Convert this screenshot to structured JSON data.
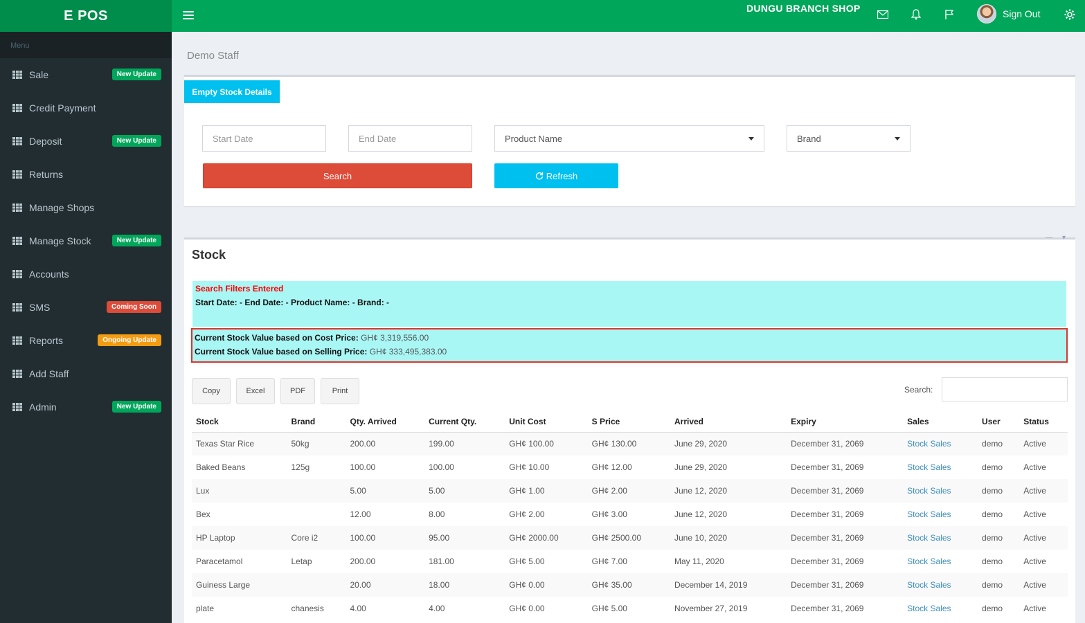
{
  "app": {
    "logo": "E POS"
  },
  "topbar": {
    "shop_name": "DUNGU BRANCH SHOP",
    "sign_out": "Sign Out"
  },
  "sidebar": {
    "header": "Menu",
    "items": [
      {
        "label": "Sale",
        "badge": "New Update",
        "badge_color": "#00a65a"
      },
      {
        "label": "Credit Payment",
        "badge": "",
        "badge_color": ""
      },
      {
        "label": "Deposit",
        "badge": "New Update",
        "badge_color": "#00a65a"
      },
      {
        "label": "Returns",
        "badge": "",
        "badge_color": ""
      },
      {
        "label": "Manage Shops",
        "badge": "",
        "badge_color": ""
      },
      {
        "label": "Manage Stock",
        "badge": "New Update",
        "badge_color": "#00a65a"
      },
      {
        "label": "Accounts",
        "badge": "",
        "badge_color": ""
      },
      {
        "label": "SMS",
        "badge": "Coming Soon",
        "badge_color": "#dd4b39"
      },
      {
        "label": "Reports",
        "badge": "Ongoing Update",
        "badge_color": "#f39c12"
      },
      {
        "label": "Add Staff",
        "badge": "",
        "badge_color": ""
      },
      {
        "label": "Admin",
        "badge": "New Update",
        "badge_color": "#00a65a"
      }
    ]
  },
  "breadcrumb": "Demo Staff",
  "filters": {
    "tag": "Empty Stock Details",
    "start_date_placeholder": "Start Date",
    "end_date_placeholder": "End Date",
    "product_name": "Product Name",
    "brand": "Brand",
    "search_button": "Search",
    "refresh_button": "Refresh"
  },
  "stock": {
    "title": "Stock",
    "filters_heading": "Search Filters Entered",
    "filters_line": "Start Date: - End Date: - Product Name: - Brand: -",
    "cost_label": "Current Stock Value based on Cost Price:",
    "cost_value": "GH¢ 3,319,556.00",
    "selling_label": "Current Stock Value based on Selling Price:",
    "selling_value": "GH¢ 333,495,383.00",
    "export_buttons": [
      "Copy",
      "Excel",
      "PDF",
      "Print"
    ],
    "search_label": "Search:",
    "columns": [
      "Stock",
      "Brand",
      "Qty. Arrived",
      "Current Qty.",
      "Unit Cost",
      "S Price",
      "Arrived",
      "Expiry",
      "Sales",
      "User",
      "Status"
    ],
    "rows": [
      [
        "Texas Star Rice",
        "50kg",
        "200.00",
        "199.00",
        "GH¢ 100.00",
        "GH¢ 130.00",
        "June 29, 2020",
        "December 31, 2069",
        "Stock Sales",
        "demo",
        "Active"
      ],
      [
        "Baked Beans",
        "125g",
        "100.00",
        "100.00",
        "GH¢ 10.00",
        "GH¢ 12.00",
        "June 29, 2020",
        "December 31, 2069",
        "Stock Sales",
        "demo",
        "Active"
      ],
      [
        "Lux",
        "",
        "5.00",
        "5.00",
        "GH¢ 1.00",
        "GH¢ 2.00",
        "June 12, 2020",
        "December 31, 2069",
        "Stock Sales",
        "demo",
        "Active"
      ],
      [
        "Bex",
        "",
        "12.00",
        "8.00",
        "GH¢ 2.00",
        "GH¢ 3.00",
        "June 12, 2020",
        "December 31, 2069",
        "Stock Sales",
        "demo",
        "Active"
      ],
      [
        "HP Laptop",
        "Core i2",
        "100.00",
        "95.00",
        "GH¢ 2000.00",
        "GH¢ 2500.00",
        "June 10, 2020",
        "December 31, 2069",
        "Stock Sales",
        "demo",
        "Active"
      ],
      [
        "Paracetamol",
        "Letap",
        "200.00",
        "181.00",
        "GH¢ 5.00",
        "GH¢ 7.00",
        "May 11, 2020",
        "December 31, 2069",
        "Stock Sales",
        "demo",
        "Active"
      ],
      [
        "Guiness Large",
        "",
        "20.00",
        "18.00",
        "GH¢ 0.00",
        "GH¢ 35.00",
        "December 14, 2019",
        "December 31, 2069",
        "Stock Sales",
        "demo",
        "Active"
      ],
      [
        "plate",
        "chanesis",
        "4.00",
        "4.00",
        "GH¢ 0.00",
        "GH¢ 5.00",
        "November 27, 2019",
        "December 31, 2069",
        "Stock Sales",
        "demo",
        "Active"
      ]
    ]
  }
}
